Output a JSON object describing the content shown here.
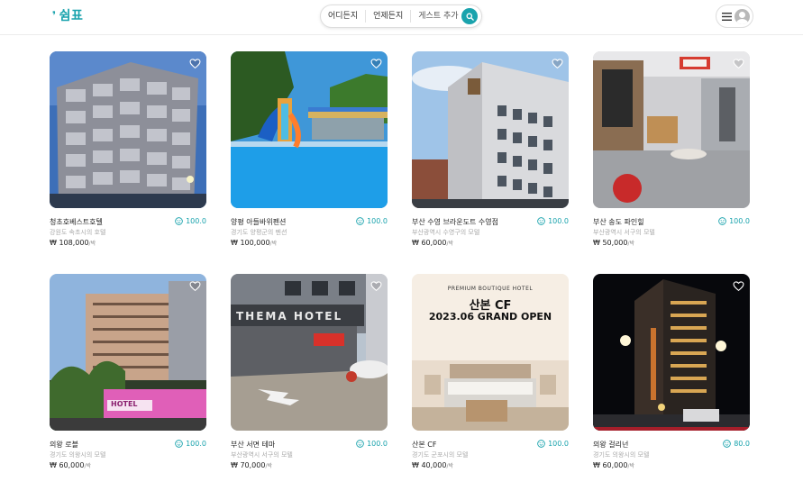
{
  "app": {
    "logo_text": "쉼표",
    "brand_color": "#1aa3ad"
  },
  "header": {
    "search_where": "어디든지",
    "search_when": "언제든지",
    "search_guest": "게스트 추가"
  },
  "cards": [
    {
      "title": "청초호베스트호텔",
      "rating": "100.0",
      "address": "강원도 속초시의 호텔",
      "price": "₩ 108,000",
      "unit": "/박"
    },
    {
      "title": "양평 아들바위펜션",
      "rating": "100.0",
      "address": "경기도 양평군의 펜션",
      "price": "₩ 100,000",
      "unit": "/박"
    },
    {
      "title": "부산 수영 브라운도트 수영점",
      "rating": "100.0",
      "address": "부산광역시 수영구의 모텔",
      "price": "₩ 60,000",
      "unit": "/박"
    },
    {
      "title": "부산 송도 파인힐",
      "rating": "100.0",
      "address": "부산광역시 서구의 모텔",
      "price": "₩ 50,000",
      "unit": "/박"
    },
    {
      "title": "의왕 로블",
      "rating": "100.0",
      "address": "경기도 의왕시의 모텔",
      "price": "₩ 60,000",
      "unit": "/박"
    },
    {
      "title": "부산 서면 테마",
      "rating": "100.0",
      "address": "부산광역시 서구의 모텔",
      "price": "₩ 70,000",
      "unit": "/박"
    },
    {
      "title": "산본 CF",
      "rating": "100.0",
      "address": "경기도 군포시의 모텔",
      "price": "₩ 40,000",
      "unit": "/박"
    },
    {
      "title": "의왕 걸리넌",
      "rating": "80.0",
      "address": "경기도 의왕시의 모텔",
      "price": "₩ 60,000",
      "unit": "/박"
    }
  ],
  "photo_text": {
    "thema_sign": "THEMA HOTEL",
    "motel_sign": "HOTEL",
    "cf_top": "PREMIUM BOUTIQUE HOTEL",
    "cf_name": "산본 CF",
    "cf_open": "2023.06 GRAND OPEN"
  },
  "icons": {
    "logo": "comma-mark-icon",
    "search": "search-icon",
    "menu": "hamburger-icon",
    "avatar": "user-icon",
    "wishlist": "heart-icon",
    "rating": "smile-icon"
  }
}
